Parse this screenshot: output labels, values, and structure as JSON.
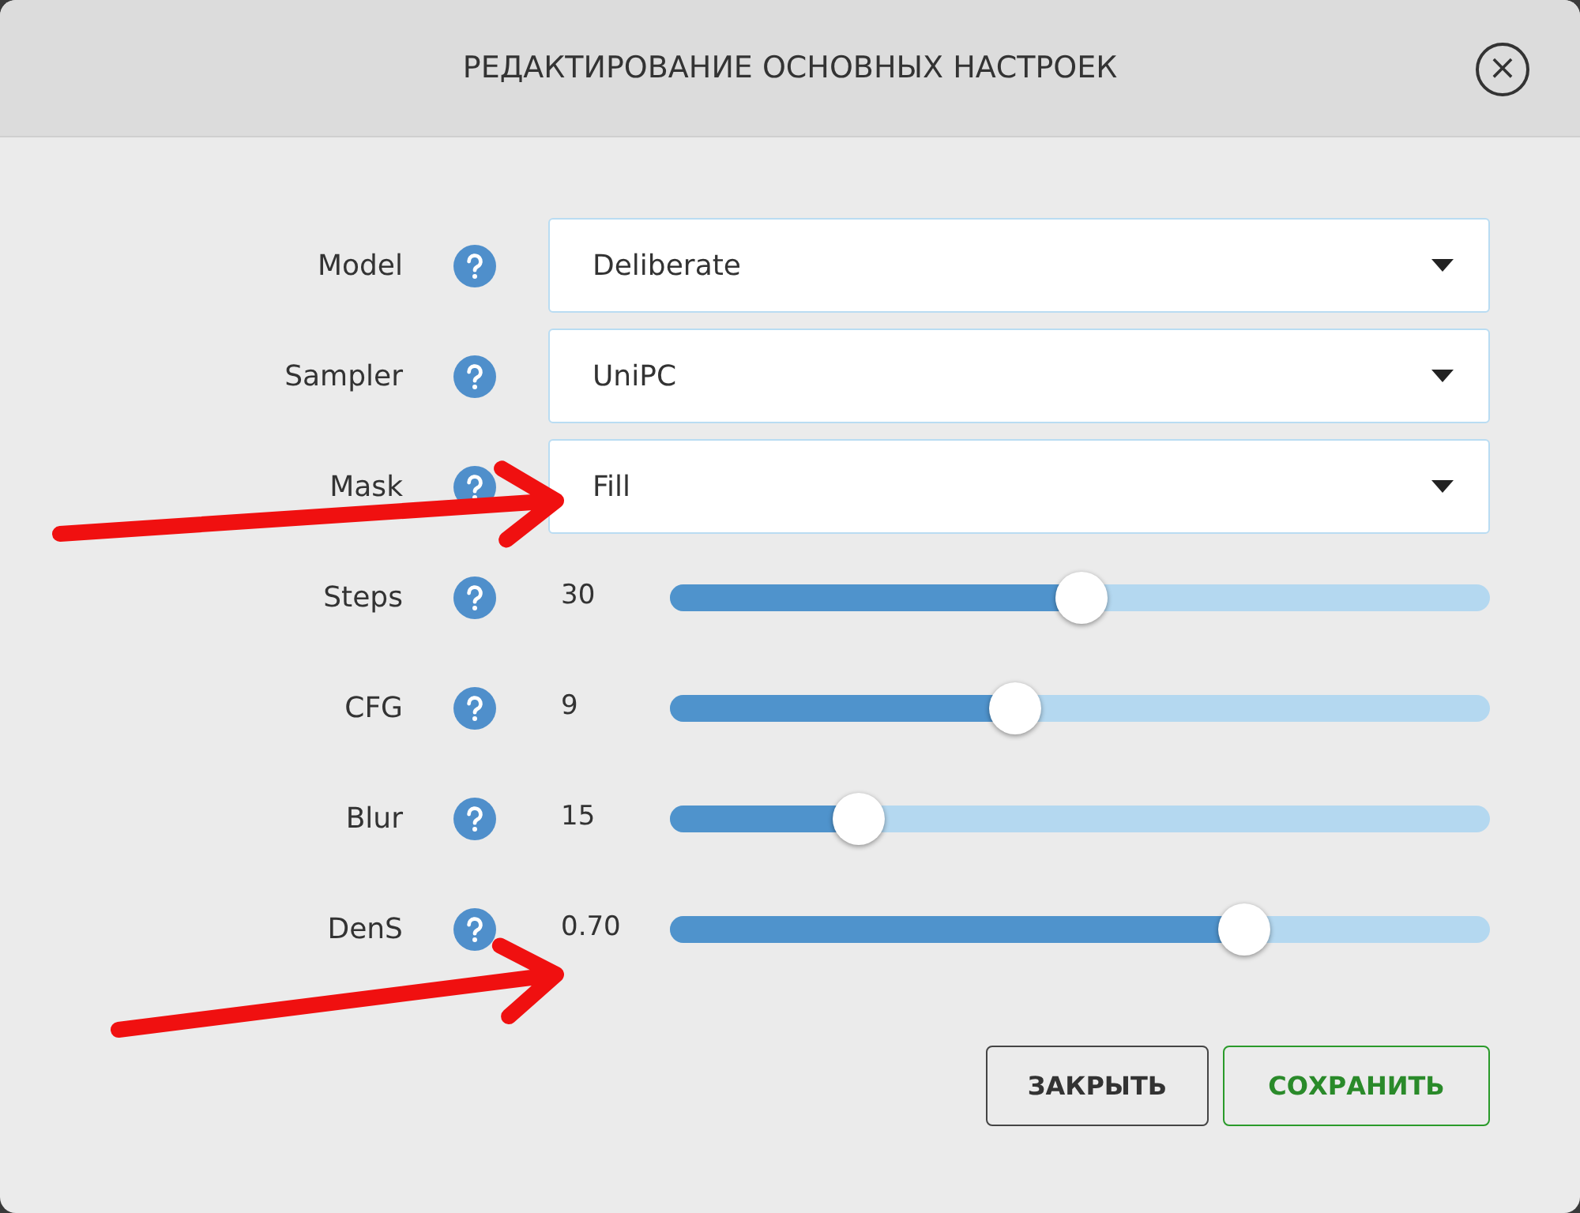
{
  "dialog": {
    "title": "РЕДАКТИРОВАНИЕ ОСНОВНЫХ НАСТРОЕК",
    "close": "×"
  },
  "settings": [
    {
      "label": "Model",
      "kind": "select",
      "value": "Deliberate"
    },
    {
      "label": "Sampler",
      "kind": "select",
      "value": "UniPC"
    },
    {
      "label": "Mask",
      "kind": "select",
      "value": "Fill"
    },
    {
      "label": "Steps",
      "kind": "slider",
      "reading": "30",
      "level": 0.5
    },
    {
      "label": "CFG",
      "kind": "slider",
      "reading": "9",
      "level": 0.42
    },
    {
      "label": "Blur",
      "kind": "slider",
      "reading": "15",
      "level": 0.23
    },
    {
      "label": "DenS",
      "kind": "slider",
      "reading": "0.70",
      "level": 0.7
    }
  ],
  "buttons": [
    {
      "label": "ЗАКРЫТЬ",
      "kind": "secondary"
    },
    {
      "label": "СОХРАНИТЬ",
      "kind": "primary"
    }
  ],
  "annotations": [
    {
      "kind": "arrow"
    },
    {
      "kind": "arrow"
    }
  ]
}
